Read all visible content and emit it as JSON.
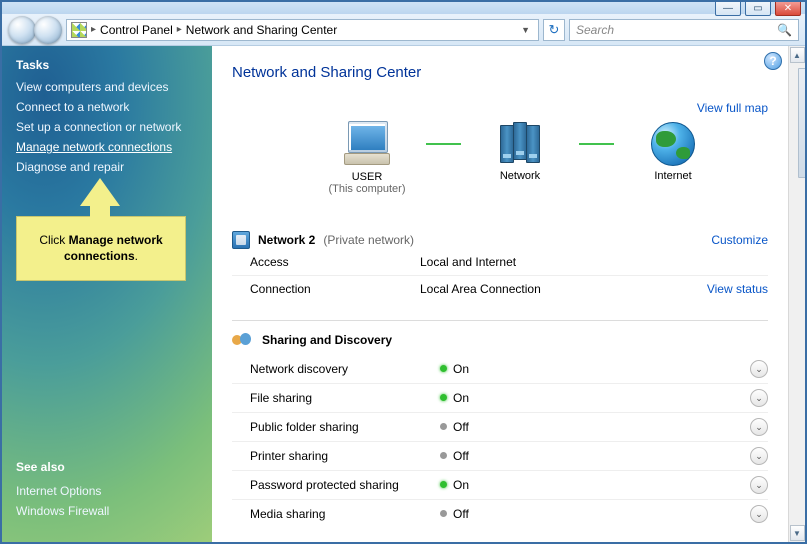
{
  "titlebar": {
    "min": "—",
    "max": "▭",
    "close": "✕"
  },
  "nav": {
    "back": "",
    "fwd": "",
    "crumb1": "Control Panel",
    "crumb2": "Network and Sharing Center",
    "sep": "▸",
    "drop": "▼",
    "refresh": "↻",
    "search_placeholder": "Search",
    "mag": "🔍"
  },
  "sidebar": {
    "tasks_hdr": "Tasks",
    "tasks": [
      "View computers and devices",
      "Connect to a network",
      "Set up a connection or network",
      "Manage network connections",
      "Diagnose and repair"
    ],
    "see_also_hdr": "See also",
    "see_also": [
      "Internet Options",
      "Windows Firewall"
    ]
  },
  "callout": {
    "pre": "Click ",
    "bold": "Manage network connections",
    "post": "."
  },
  "page": {
    "help": "?",
    "title": "Network and Sharing Center",
    "view_full_map": "View full map"
  },
  "map": {
    "user": "USER",
    "user_sub": "(This computer)",
    "network": "Network",
    "internet": "Internet"
  },
  "net": {
    "name": "Network 2",
    "type": "(Private network)",
    "customize": "Customize",
    "access_k": "Access",
    "access_v": "Local and Internet",
    "conn_k": "Connection",
    "conn_v": "Local Area Connection",
    "view_status": "View status"
  },
  "sharing": {
    "hdr": "Sharing and Discovery",
    "rows": [
      {
        "k": "Network discovery",
        "on": true,
        "v": "On"
      },
      {
        "k": "File sharing",
        "on": true,
        "v": "On"
      },
      {
        "k": "Public folder sharing",
        "on": false,
        "v": "Off"
      },
      {
        "k": "Printer sharing",
        "on": false,
        "v": "Off"
      },
      {
        "k": "Password protected sharing",
        "on": true,
        "v": "On"
      },
      {
        "k": "Media sharing",
        "on": false,
        "v": "Off"
      }
    ],
    "chev": "⌄"
  },
  "scroll": {
    "up": "▲",
    "down": "▼"
  }
}
